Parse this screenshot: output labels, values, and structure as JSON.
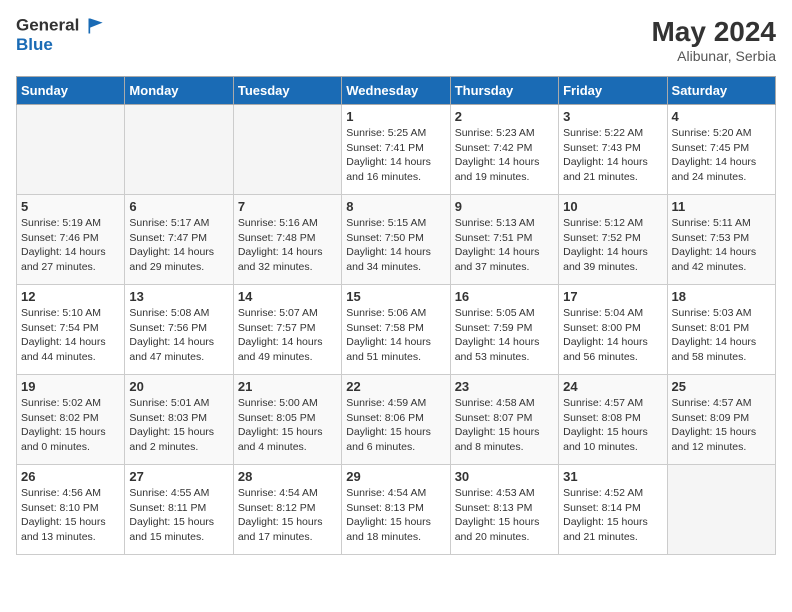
{
  "header": {
    "logo_general": "General",
    "logo_blue": "Blue",
    "month_year": "May 2024",
    "location": "Alibunar, Serbia"
  },
  "weekdays": [
    "Sunday",
    "Monday",
    "Tuesday",
    "Wednesday",
    "Thursday",
    "Friday",
    "Saturday"
  ],
  "weeks": [
    [
      {
        "day": "",
        "info": ""
      },
      {
        "day": "",
        "info": ""
      },
      {
        "day": "",
        "info": ""
      },
      {
        "day": "1",
        "info": "Sunrise: 5:25 AM\nSunset: 7:41 PM\nDaylight: 14 hours and 16 minutes."
      },
      {
        "day": "2",
        "info": "Sunrise: 5:23 AM\nSunset: 7:42 PM\nDaylight: 14 hours and 19 minutes."
      },
      {
        "day": "3",
        "info": "Sunrise: 5:22 AM\nSunset: 7:43 PM\nDaylight: 14 hours and 21 minutes."
      },
      {
        "day": "4",
        "info": "Sunrise: 5:20 AM\nSunset: 7:45 PM\nDaylight: 14 hours and 24 minutes."
      }
    ],
    [
      {
        "day": "5",
        "info": "Sunrise: 5:19 AM\nSunset: 7:46 PM\nDaylight: 14 hours and 27 minutes."
      },
      {
        "day": "6",
        "info": "Sunrise: 5:17 AM\nSunset: 7:47 PM\nDaylight: 14 hours and 29 minutes."
      },
      {
        "day": "7",
        "info": "Sunrise: 5:16 AM\nSunset: 7:48 PM\nDaylight: 14 hours and 32 minutes."
      },
      {
        "day": "8",
        "info": "Sunrise: 5:15 AM\nSunset: 7:50 PM\nDaylight: 14 hours and 34 minutes."
      },
      {
        "day": "9",
        "info": "Sunrise: 5:13 AM\nSunset: 7:51 PM\nDaylight: 14 hours and 37 minutes."
      },
      {
        "day": "10",
        "info": "Sunrise: 5:12 AM\nSunset: 7:52 PM\nDaylight: 14 hours and 39 minutes."
      },
      {
        "day": "11",
        "info": "Sunrise: 5:11 AM\nSunset: 7:53 PM\nDaylight: 14 hours and 42 minutes."
      }
    ],
    [
      {
        "day": "12",
        "info": "Sunrise: 5:10 AM\nSunset: 7:54 PM\nDaylight: 14 hours and 44 minutes."
      },
      {
        "day": "13",
        "info": "Sunrise: 5:08 AM\nSunset: 7:56 PM\nDaylight: 14 hours and 47 minutes."
      },
      {
        "day": "14",
        "info": "Sunrise: 5:07 AM\nSunset: 7:57 PM\nDaylight: 14 hours and 49 minutes."
      },
      {
        "day": "15",
        "info": "Sunrise: 5:06 AM\nSunset: 7:58 PM\nDaylight: 14 hours and 51 minutes."
      },
      {
        "day": "16",
        "info": "Sunrise: 5:05 AM\nSunset: 7:59 PM\nDaylight: 14 hours and 53 minutes."
      },
      {
        "day": "17",
        "info": "Sunrise: 5:04 AM\nSunset: 8:00 PM\nDaylight: 14 hours and 56 minutes."
      },
      {
        "day": "18",
        "info": "Sunrise: 5:03 AM\nSunset: 8:01 PM\nDaylight: 14 hours and 58 minutes."
      }
    ],
    [
      {
        "day": "19",
        "info": "Sunrise: 5:02 AM\nSunset: 8:02 PM\nDaylight: 15 hours and 0 minutes."
      },
      {
        "day": "20",
        "info": "Sunrise: 5:01 AM\nSunset: 8:03 PM\nDaylight: 15 hours and 2 minutes."
      },
      {
        "day": "21",
        "info": "Sunrise: 5:00 AM\nSunset: 8:05 PM\nDaylight: 15 hours and 4 minutes."
      },
      {
        "day": "22",
        "info": "Sunrise: 4:59 AM\nSunset: 8:06 PM\nDaylight: 15 hours and 6 minutes."
      },
      {
        "day": "23",
        "info": "Sunrise: 4:58 AM\nSunset: 8:07 PM\nDaylight: 15 hours and 8 minutes."
      },
      {
        "day": "24",
        "info": "Sunrise: 4:57 AM\nSunset: 8:08 PM\nDaylight: 15 hours and 10 minutes."
      },
      {
        "day": "25",
        "info": "Sunrise: 4:57 AM\nSunset: 8:09 PM\nDaylight: 15 hours and 12 minutes."
      }
    ],
    [
      {
        "day": "26",
        "info": "Sunrise: 4:56 AM\nSunset: 8:10 PM\nDaylight: 15 hours and 13 minutes."
      },
      {
        "day": "27",
        "info": "Sunrise: 4:55 AM\nSunset: 8:11 PM\nDaylight: 15 hours and 15 minutes."
      },
      {
        "day": "28",
        "info": "Sunrise: 4:54 AM\nSunset: 8:12 PM\nDaylight: 15 hours and 17 minutes."
      },
      {
        "day": "29",
        "info": "Sunrise: 4:54 AM\nSunset: 8:13 PM\nDaylight: 15 hours and 18 minutes."
      },
      {
        "day": "30",
        "info": "Sunrise: 4:53 AM\nSunset: 8:13 PM\nDaylight: 15 hours and 20 minutes."
      },
      {
        "day": "31",
        "info": "Sunrise: 4:52 AM\nSunset: 8:14 PM\nDaylight: 15 hours and 21 minutes."
      },
      {
        "day": "",
        "info": ""
      }
    ]
  ]
}
